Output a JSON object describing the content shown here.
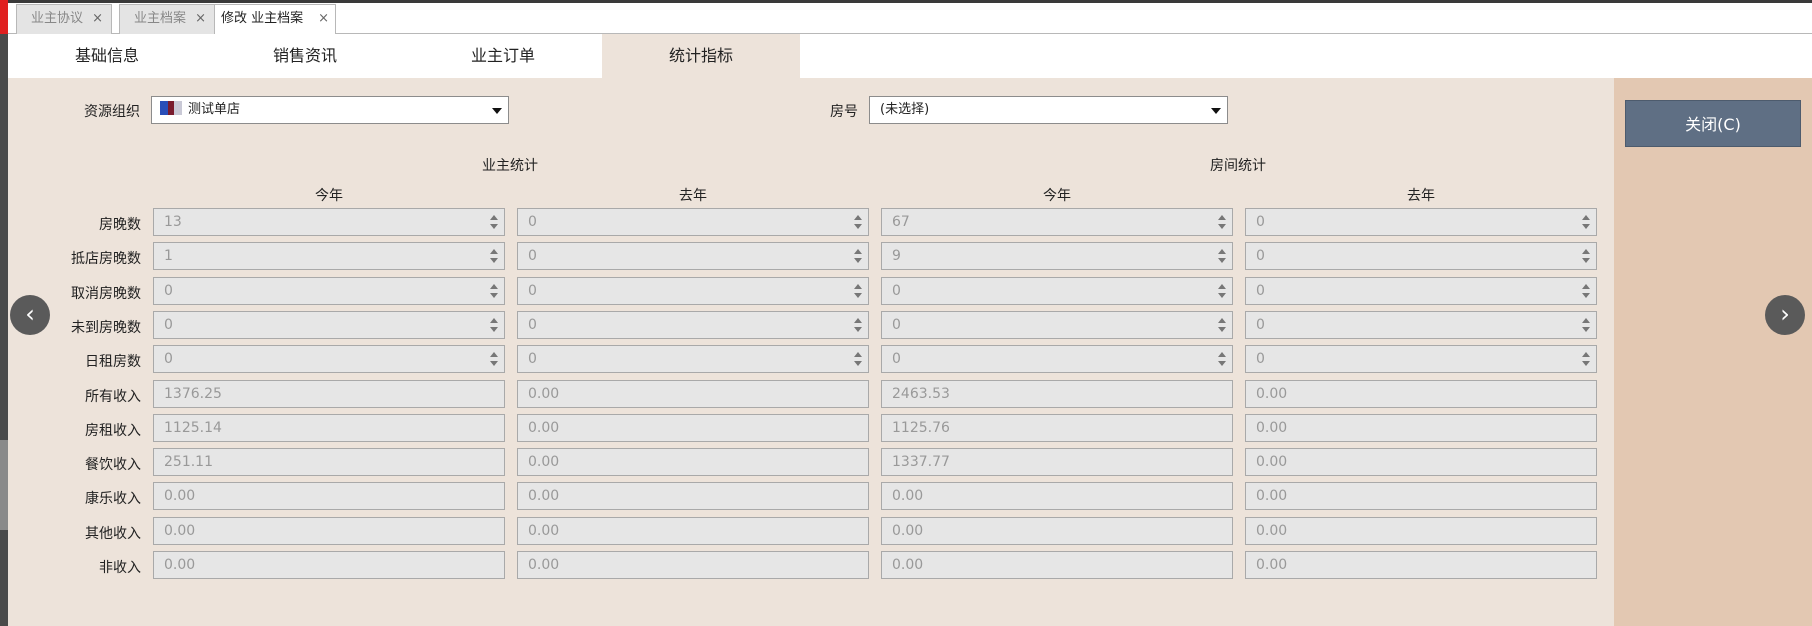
{
  "doc_tabs": [
    {
      "label": "业主协议"
    },
    {
      "label": "业主档案"
    },
    {
      "label": "修改 业主档案",
      "active": true
    }
  ],
  "close_glyph": "×",
  "section_tabs": [
    {
      "label": "基础信息"
    },
    {
      "label": "销售资讯"
    },
    {
      "label": "业主订单"
    },
    {
      "label": "统计指标",
      "active": true
    }
  ],
  "filters": {
    "org_label": "资源组织",
    "org_value": "测试单店",
    "room_label": "房号",
    "room_value": "(未选择)"
  },
  "close_button": "关闭(C)",
  "groups": {
    "owner": "业主统计",
    "room": "房间统计"
  },
  "columns": [
    "今年",
    "去年",
    "今年",
    "去年"
  ],
  "rows": [
    {
      "label": "房晚数",
      "spin": true,
      "values": [
        "13",
        "0",
        "67",
        "0"
      ]
    },
    {
      "label": "抵店房晚数",
      "spin": true,
      "values": [
        "1",
        "0",
        "9",
        "0"
      ]
    },
    {
      "label": "取消房晚数",
      "spin": true,
      "values": [
        "0",
        "0",
        "0",
        "0"
      ]
    },
    {
      "label": "未到房晚数",
      "spin": true,
      "values": [
        "0",
        "0",
        "0",
        "0"
      ]
    },
    {
      "label": "日租房数",
      "spin": true,
      "values": [
        "0",
        "0",
        "0",
        "0"
      ]
    },
    {
      "label": "所有收入",
      "spin": false,
      "values": [
        "1376.25",
        "0.00",
        "2463.53",
        "0.00"
      ]
    },
    {
      "label": "房租收入",
      "spin": false,
      "values": [
        "1125.14",
        "0.00",
        "1125.76",
        "0.00"
      ]
    },
    {
      "label": "餐饮收入",
      "spin": false,
      "values": [
        "251.11",
        "0.00",
        "1337.77",
        "0.00"
      ]
    },
    {
      "label": "康乐收入",
      "spin": false,
      "values": [
        "0.00",
        "0.00",
        "0.00",
        "0.00"
      ]
    },
    {
      "label": "其他收入",
      "spin": false,
      "values": [
        "0.00",
        "0.00",
        "0.00",
        "0.00"
      ]
    },
    {
      "label": "非收入",
      "spin": false,
      "values": [
        "0.00",
        "0.00",
        "0.00",
        "0.00"
      ]
    }
  ],
  "nav": {
    "prev": "‹",
    "next": "›"
  },
  "colors": {
    "panel": "#ede3da",
    "side": "#e3c8b2",
    "button": "#5f6f84"
  }
}
